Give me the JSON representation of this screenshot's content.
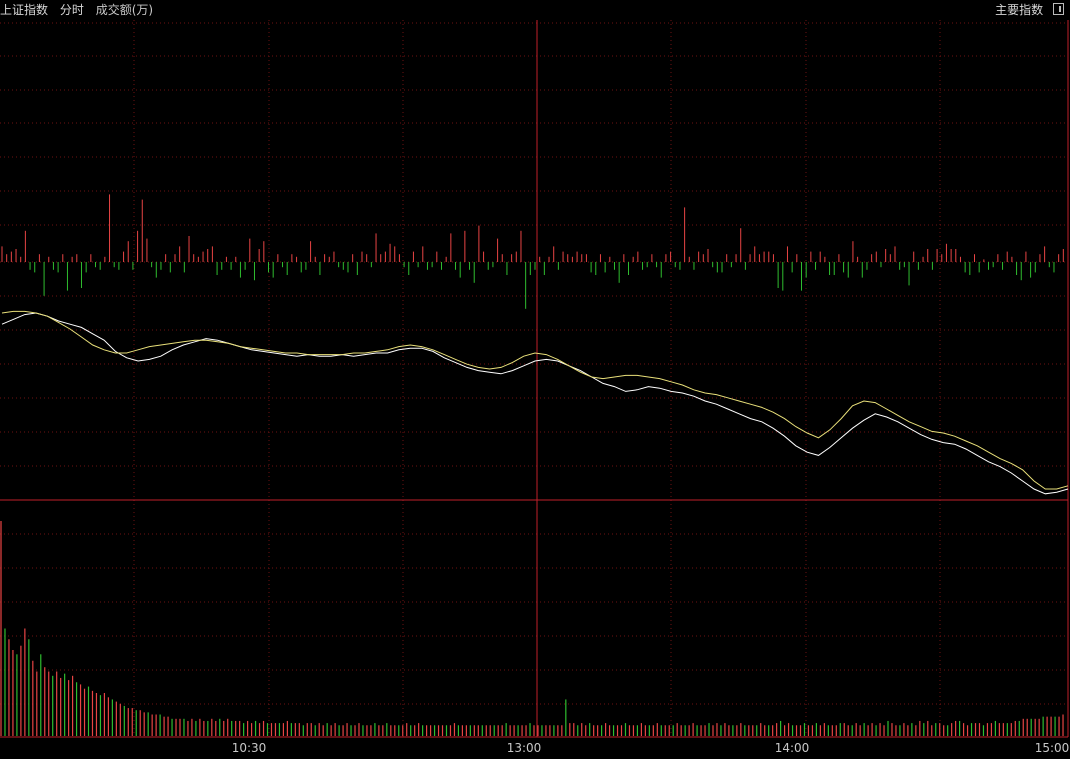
{
  "header": {
    "index_name": "上证指数",
    "mode": "分时",
    "volume_label": "成交额(万)",
    "main_index_button": "主要指数"
  },
  "colors": {
    "background": "#000000",
    "grid": "#6e1212",
    "axis_red": "#c0202a",
    "up": "#e84444",
    "down": "#2fbd2f",
    "price_line": "#ffffff",
    "avg_line": "#e9e07a",
    "tick_text": "#c8c8c8"
  },
  "chart_data": {
    "type": "line",
    "x_ticks": [
      "10:30",
      "13:00",
      "14:00",
      "15:00"
    ],
    "series": [
      {
        "values": [
          1.3,
          1.6,
          1.9,
          2.0,
          1.8,
          1.5,
          1.3,
          1.1,
          0.7,
          0.3,
          -0.4,
          -0.8,
          -1.0,
          -0.9,
          -0.7,
          -0.3,
          0.0,
          0.2,
          0.4,
          0.3,
          0.1,
          -0.1,
          -0.3,
          -0.4,
          -0.5,
          -0.6,
          -0.7,
          -0.6,
          -0.7,
          -0.7,
          -0.6,
          -0.7,
          -0.6,
          -0.5,
          -0.5,
          -0.3,
          -0.2,
          -0.2,
          -0.4,
          -0.8,
          -1.1,
          -1.4,
          -1.6,
          -1.7,
          -1.8,
          -1.6,
          -1.3,
          -1.0,
          -0.9,
          -1.0,
          -1.3,
          -1.6,
          -2.0,
          -2.4,
          -2.6,
          -2.9,
          -2.8,
          -2.6,
          -2.7,
          -2.9,
          -3.0,
          -3.2,
          -3.5,
          -3.7,
          -4.0,
          -4.3,
          -4.6,
          -4.8,
          -5.2,
          -5.7,
          -6.3,
          -6.7,
          -6.9,
          -6.4,
          -5.8,
          -5.2,
          -4.7,
          -4.3,
          -4.5,
          -4.8,
          -5.2,
          -5.6,
          -5.9,
          -6.1,
          -6.2,
          -6.5,
          -6.9,
          -7.3,
          -7.6,
          -8.0,
          -8.5,
          -9.0,
          -9.3,
          -9.2,
          -9.0
        ]
      },
      {
        "values": [
          2.0,
          2.1,
          2.1,
          2.0,
          1.8,
          1.4,
          1.0,
          0.5,
          0.0,
          -0.3,
          -0.5,
          -0.5,
          -0.3,
          -0.1,
          0.0,
          0.1,
          0.2,
          0.3,
          0.3,
          0.2,
          0.1,
          -0.1,
          -0.2,
          -0.3,
          -0.4,
          -0.5,
          -0.5,
          -0.6,
          -0.6,
          -0.6,
          -0.6,
          -0.5,
          -0.5,
          -0.4,
          -0.3,
          -0.1,
          0.0,
          -0.1,
          -0.3,
          -0.6,
          -0.9,
          -1.2,
          -1.4,
          -1.5,
          -1.4,
          -1.1,
          -0.7,
          -0.5,
          -0.6,
          -0.9,
          -1.3,
          -1.7,
          -2.0,
          -2.1,
          -2.0,
          -1.9,
          -1.9,
          -2.0,
          -2.1,
          -2.3,
          -2.5,
          -2.8,
          -3.0,
          -3.1,
          -3.3,
          -3.5,
          -3.7,
          -3.9,
          -4.2,
          -4.6,
          -5.1,
          -5.5,
          -5.8,
          -5.3,
          -4.6,
          -3.8,
          -3.5,
          -3.6,
          -4.0,
          -4.4,
          -4.8,
          -5.1,
          -5.4,
          -5.5,
          -5.7,
          -6.0,
          -6.3,
          -6.7,
          -7.1,
          -7.4,
          -7.8,
          -8.5,
          -9.0,
          -9.0,
          -8.8
        ]
      }
    ],
    "net_flow_values": [
      6,
      3,
      4,
      5,
      2,
      12,
      3,
      4,
      3,
      13,
      2,
      3,
      4,
      3,
      11,
      2,
      3,
      10,
      4,
      3,
      2,
      3,
      2,
      26,
      2,
      3,
      4,
      8,
      3,
      12,
      24,
      9,
      2,
      6,
      3,
      3,
      4,
      3,
      6,
      4,
      10,
      3,
      2,
      4,
      5,
      6,
      5,
      3,
      2,
      3,
      2,
      6,
      3,
      9,
      7,
      5,
      8,
      4,
      6,
      3,
      2,
      5,
      3,
      2,
      4,
      3,
      8,
      2,
      5,
      3,
      2,
      4,
      2,
      3,
      4,
      3,
      5,
      4,
      3,
      2,
      11,
      3,
      4,
      7,
      6,
      3,
      2,
      5,
      4,
      2,
      6,
      3,
      2,
      4,
      3,
      2,
      11,
      3,
      6,
      12,
      3,
      8,
      14,
      4,
      3,
      2,
      9,
      3,
      5,
      3,
      4,
      12,
      18,
      5,
      3,
      2,
      5,
      2,
      6,
      3,
      4,
      3,
      2,
      4,
      3,
      3,
      4,
      5,
      3,
      4,
      2,
      3,
      8,
      3,
      5,
      2,
      4,
      3,
      2,
      3,
      2,
      6,
      3,
      4,
      2,
      3,
      21,
      2,
      3,
      4,
      3,
      5,
      2,
      4,
      4,
      3,
      2,
      3,
      13,
      3,
      3,
      6,
      3,
      4,
      4,
      3,
      10,
      11,
      6,
      4,
      3,
      11,
      6,
      4,
      3,
      4,
      2,
      5,
      5,
      3,
      4,
      6,
      8,
      2,
      6,
      3,
      3,
      4,
      2,
      5,
      3,
      6,
      3,
      2,
      9,
      4,
      3,
      2,
      5,
      3,
      5,
      3,
      7,
      5,
      5,
      2,
      4,
      5,
      3,
      4,
      1,
      3,
      2,
      3,
      3,
      4,
      2,
      5,
      7,
      4,
      6,
      4,
      3,
      6,
      2,
      4,
      3,
      5
    ],
    "volume_values": [
      100,
      50,
      45,
      40,
      38,
      42,
      50,
      45,
      35,
      30,
      38,
      32,
      30,
      28,
      30,
      27,
      29,
      26,
      28,
      25,
      24,
      22,
      23,
      21,
      20,
      19,
      20,
      18,
      17,
      16,
      15,
      14,
      13,
      13,
      12,
      12,
      11,
      11,
      10,
      10,
      10,
      9,
      9,
      8,
      8,
      8,
      8,
      7,
      8,
      7,
      8,
      7,
      7,
      8,
      7,
      8,
      7,
      8,
      7,
      7,
      7,
      6,
      7,
      6,
      7,
      6,
      7,
      6,
      6,
      6,
      6,
      6,
      7,
      6,
      6,
      6,
      5,
      6,
      6,
      5,
      6,
      5,
      6,
      5,
      6,
      5,
      5,
      6,
      5,
      5,
      6,
      5,
      5,
      5,
      6,
      5,
      5,
      6,
      5,
      5,
      5,
      5,
      6,
      5,
      5,
      6,
      5,
      5,
      5,
      5,
      5,
      5,
      5,
      5,
      6,
      5,
      5,
      5,
      5,
      5,
      5,
      5,
      5,
      5,
      5,
      5,
      5,
      6,
      5,
      5,
      5,
      5,
      5,
      6,
      5,
      5,
      5,
      5,
      5,
      5,
      5,
      5,
      17,
      6,
      6,
      5,
      6,
      5,
      6,
      5,
      5,
      5,
      6,
      5,
      5,
      5,
      5,
      6,
      5,
      5,
      5,
      6,
      5,
      5,
      5,
      6,
      5,
      5,
      5,
      5,
      6,
      5,
      5,
      5,
      6,
      5,
      5,
      5,
      6,
      5,
      6,
      5,
      6,
      5,
      5,
      5,
      6,
      5,
      5,
      5,
      5,
      6,
      5,
      5,
      5,
      6,
      7,
      5,
      6,
      5,
      5,
      5,
      6,
      5,
      5,
      6,
      5,
      6,
      5,
      5,
      5,
      6,
      6,
      5,
      5,
      6,
      5,
      6,
      5,
      6,
      5,
      6,
      5,
      7,
      6,
      5,
      5,
      6,
      5,
      6,
      5,
      7,
      6,
      7,
      5,
      6,
      6,
      5,
      5,
      6,
      7,
      7,
      6,
      5,
      6,
      6,
      6,
      5,
      6,
      6,
      7,
      6,
      6,
      6,
      6,
      7,
      7,
      8,
      8,
      8,
      8,
      8,
      9,
      9,
      9,
      9,
      9,
      10
    ]
  }
}
